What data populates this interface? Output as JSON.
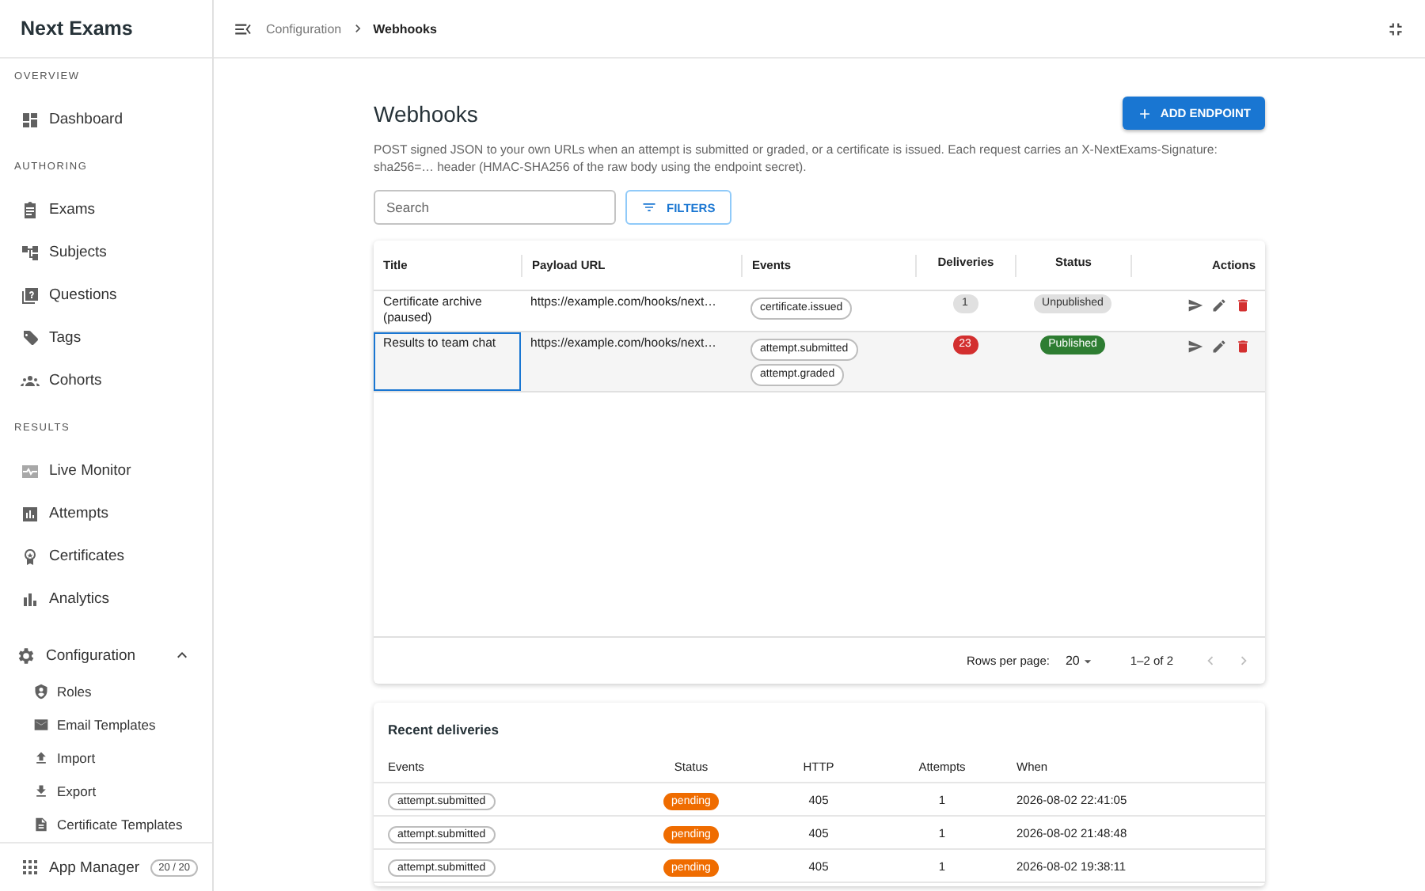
{
  "app": {
    "title": "Next Exams"
  },
  "sidebar": {
    "sections": [
      {
        "label": "OVERVIEW",
        "items": [
          {
            "label": "Dashboard",
            "kind": "dashboard"
          }
        ]
      },
      {
        "label": "AUTHORING",
        "items": [
          {
            "label": "Exams",
            "kind": "clipboard"
          },
          {
            "label": "Subjects",
            "kind": "tree"
          },
          {
            "label": "Questions",
            "kind": "question"
          },
          {
            "label": "Tags",
            "kind": "tag"
          },
          {
            "label": "Cohorts",
            "kind": "people"
          }
        ]
      },
      {
        "label": "RESULTS",
        "items": [
          {
            "label": "Live Monitor",
            "kind": "monitor"
          },
          {
            "label": "Attempts",
            "kind": "chart-box"
          },
          {
            "label": "Certificates",
            "kind": "award"
          },
          {
            "label": "Analytics",
            "kind": "bars"
          }
        ]
      }
    ],
    "group": {
      "label": "Configuration",
      "kind": "gear",
      "expanded": true,
      "children": [
        {
          "label": "Roles",
          "kind": "shield"
        },
        {
          "label": "Email Templates",
          "kind": "mail"
        },
        {
          "label": "Import",
          "kind": "upload"
        },
        {
          "label": "Export",
          "kind": "download"
        },
        {
          "label": "Certificate Templates",
          "kind": "file"
        }
      ]
    },
    "footer": {
      "label": "App Manager",
      "badge": "20 / 20"
    }
  },
  "breadcrumb": [
    {
      "label": "Configuration",
      "current": false
    },
    {
      "label": "Webhooks",
      "current": true
    }
  ],
  "page": {
    "title": "Webhooks",
    "add_button": "ADD ENDPOINT",
    "description": "POST signed JSON to your own URLs when an attempt is submitted or graded, or a certificate is issued. Each request carries an X-NextExams-Signature: sha256=… header (HMAC-SHA256 of the raw body using the endpoint secret).",
    "search": {
      "placeholder": "Search"
    },
    "filters_button": "FILTERS"
  },
  "table": {
    "columns": [
      "Title",
      "Payload URL",
      "Events",
      "Deliveries",
      "Status",
      "Actions"
    ],
    "rows": [
      {
        "title": "Certificate archive (paused)",
        "url": "https://example.com/hooks/next…",
        "events": [
          "certificate.issued"
        ],
        "deliveries": {
          "count": "1",
          "color": "#e0e0e0"
        },
        "status": {
          "label": "Unpublished",
          "published": false
        },
        "selected": false
      },
      {
        "title": "Results to team chat",
        "url": "https://example.com/hooks/next…",
        "events": [
          "attempt.submitted",
          "attempt.graded"
        ],
        "deliveries": {
          "count": "23",
          "color": "#d32f2f"
        },
        "status": {
          "label": "Published",
          "published": true
        },
        "selected": true
      }
    ],
    "pagination": {
      "rows_per_page_label": "Rows per page:",
      "rows_per_page": "20",
      "range": "1–2 of 2"
    }
  },
  "deliveries": {
    "title": "Recent deliveries",
    "columns": [
      "Events",
      "Status",
      "HTTP",
      "Attempts",
      "When"
    ],
    "rows": [
      {
        "event": "attempt.submitted",
        "status": {
          "label": "pending",
          "color": "#ef6c00"
        },
        "http": "405",
        "attempts": "1",
        "when": "2026-08-02 22:41:05"
      },
      {
        "event": "attempt.submitted",
        "status": {
          "label": "pending",
          "color": "#ef6c00"
        },
        "http": "405",
        "attempts": "1",
        "when": "2026-08-02 21:48:48"
      },
      {
        "event": "attempt.submitted",
        "status": {
          "label": "pending",
          "color": "#ef6c00"
        },
        "http": "405",
        "attempts": "1",
        "when": "2026-08-02 19:38:11"
      }
    ]
  }
}
